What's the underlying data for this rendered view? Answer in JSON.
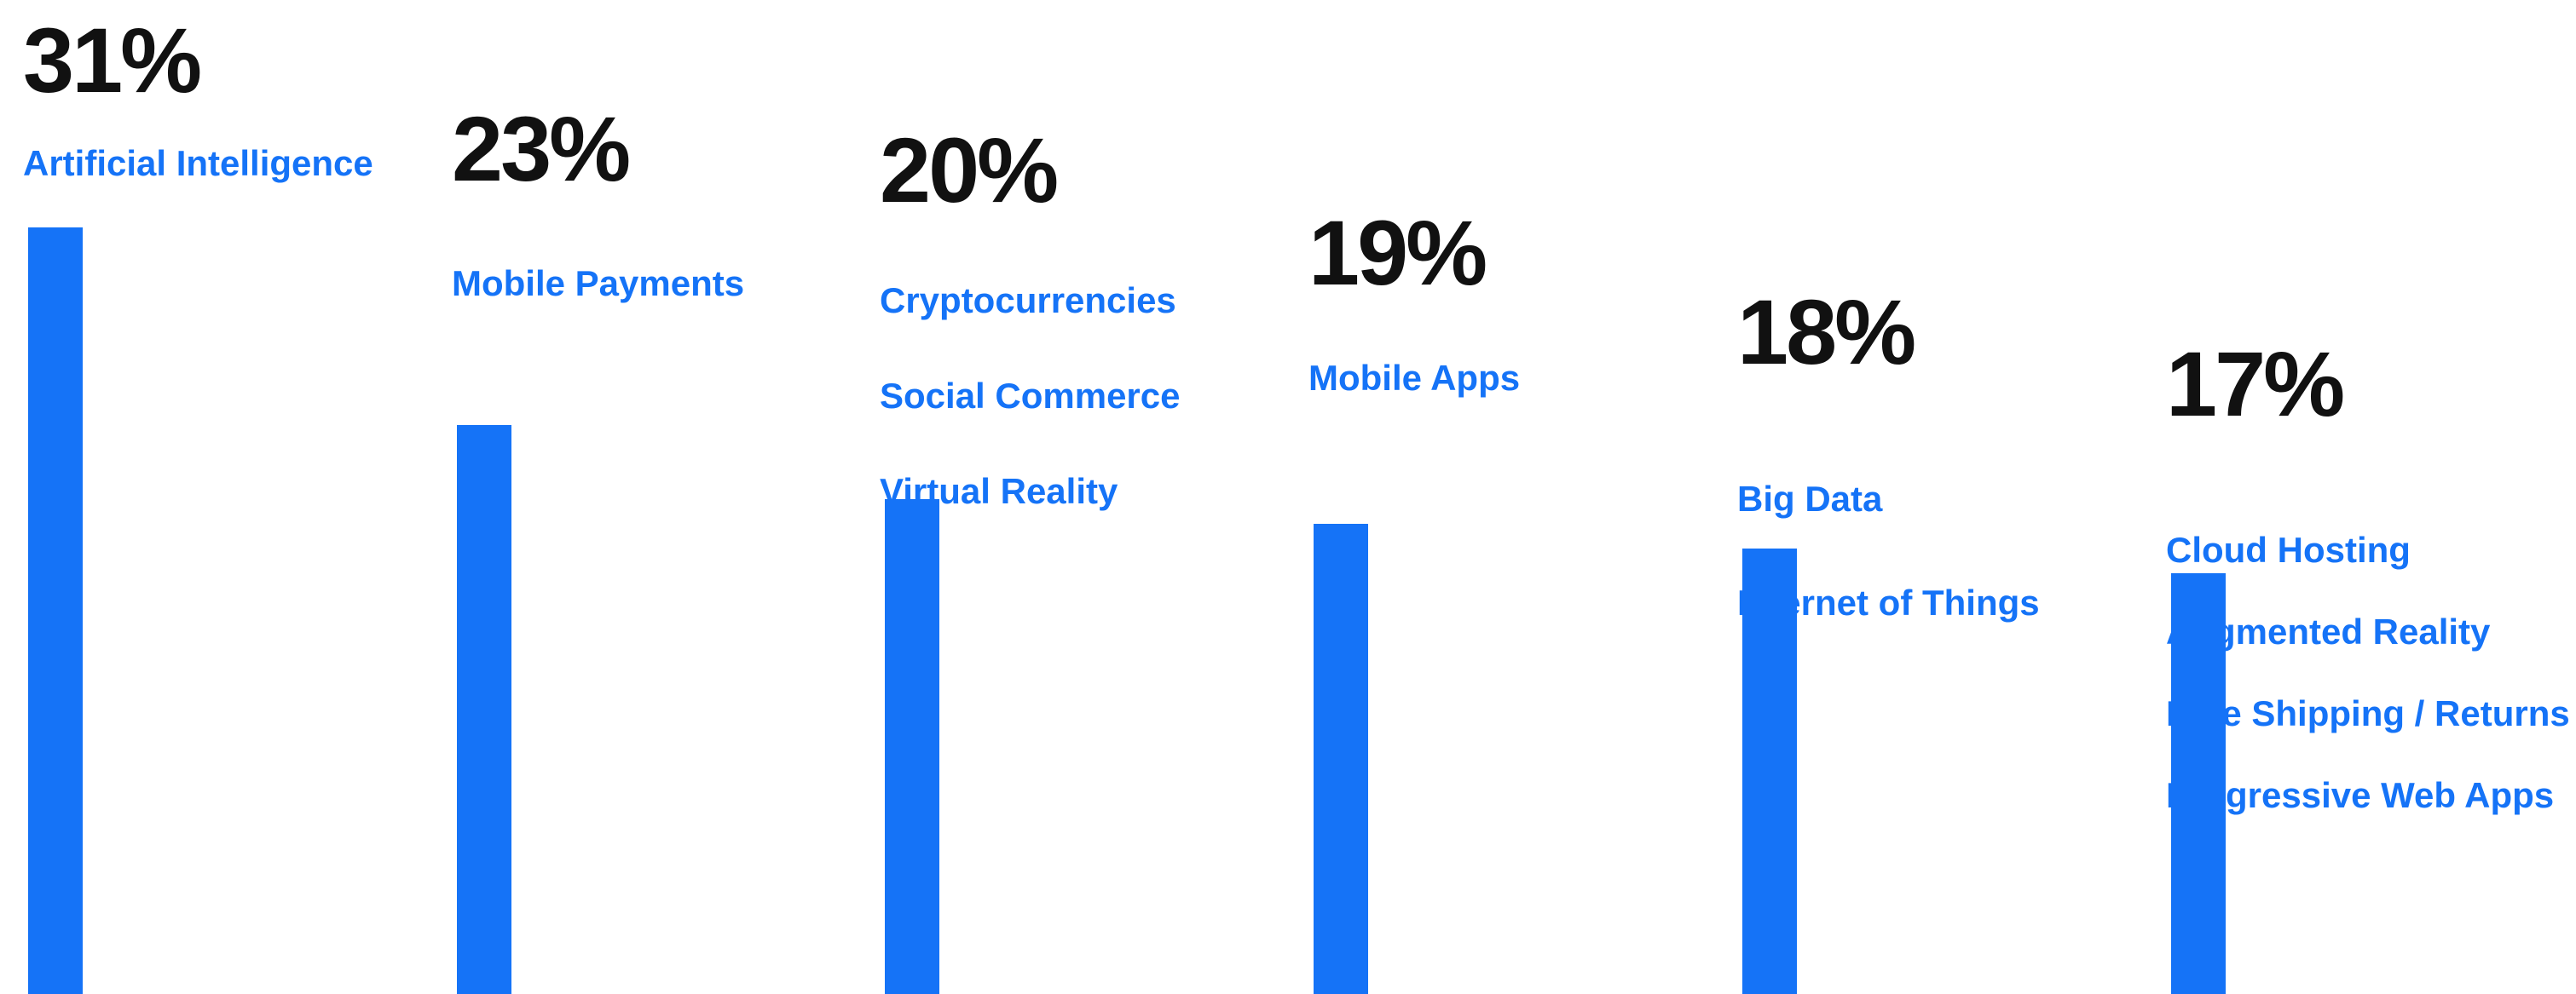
{
  "chart_data": {
    "type": "bar",
    "bar_color": "#1573f7",
    "value_color": "#111111",
    "label_color": "#1573f7",
    "groups": [
      {
        "value": 31,
        "value_label": "31%",
        "categories": [
          "Artificial Intelligence"
        ]
      },
      {
        "value": 23,
        "value_label": "23%",
        "categories": [
          "Mobile Payments"
        ]
      },
      {
        "value": 20,
        "value_label": "20%",
        "categories": [
          "Cryptocurrencies",
          "Social Commerce",
          "Virtual Reality"
        ]
      },
      {
        "value": 19,
        "value_label": "19%",
        "categories": [
          "Mobile Apps"
        ]
      },
      {
        "value": 18,
        "value_label": "18%",
        "categories": [
          "Big Data",
          "Internet of Things"
        ]
      },
      {
        "value": 17,
        "value_label": "17%",
        "categories": [
          "Cloud Hosting",
          "Augmented Reality",
          "Free Shipping / Returns",
          "Progressive Web Apps"
        ]
      }
    ]
  }
}
